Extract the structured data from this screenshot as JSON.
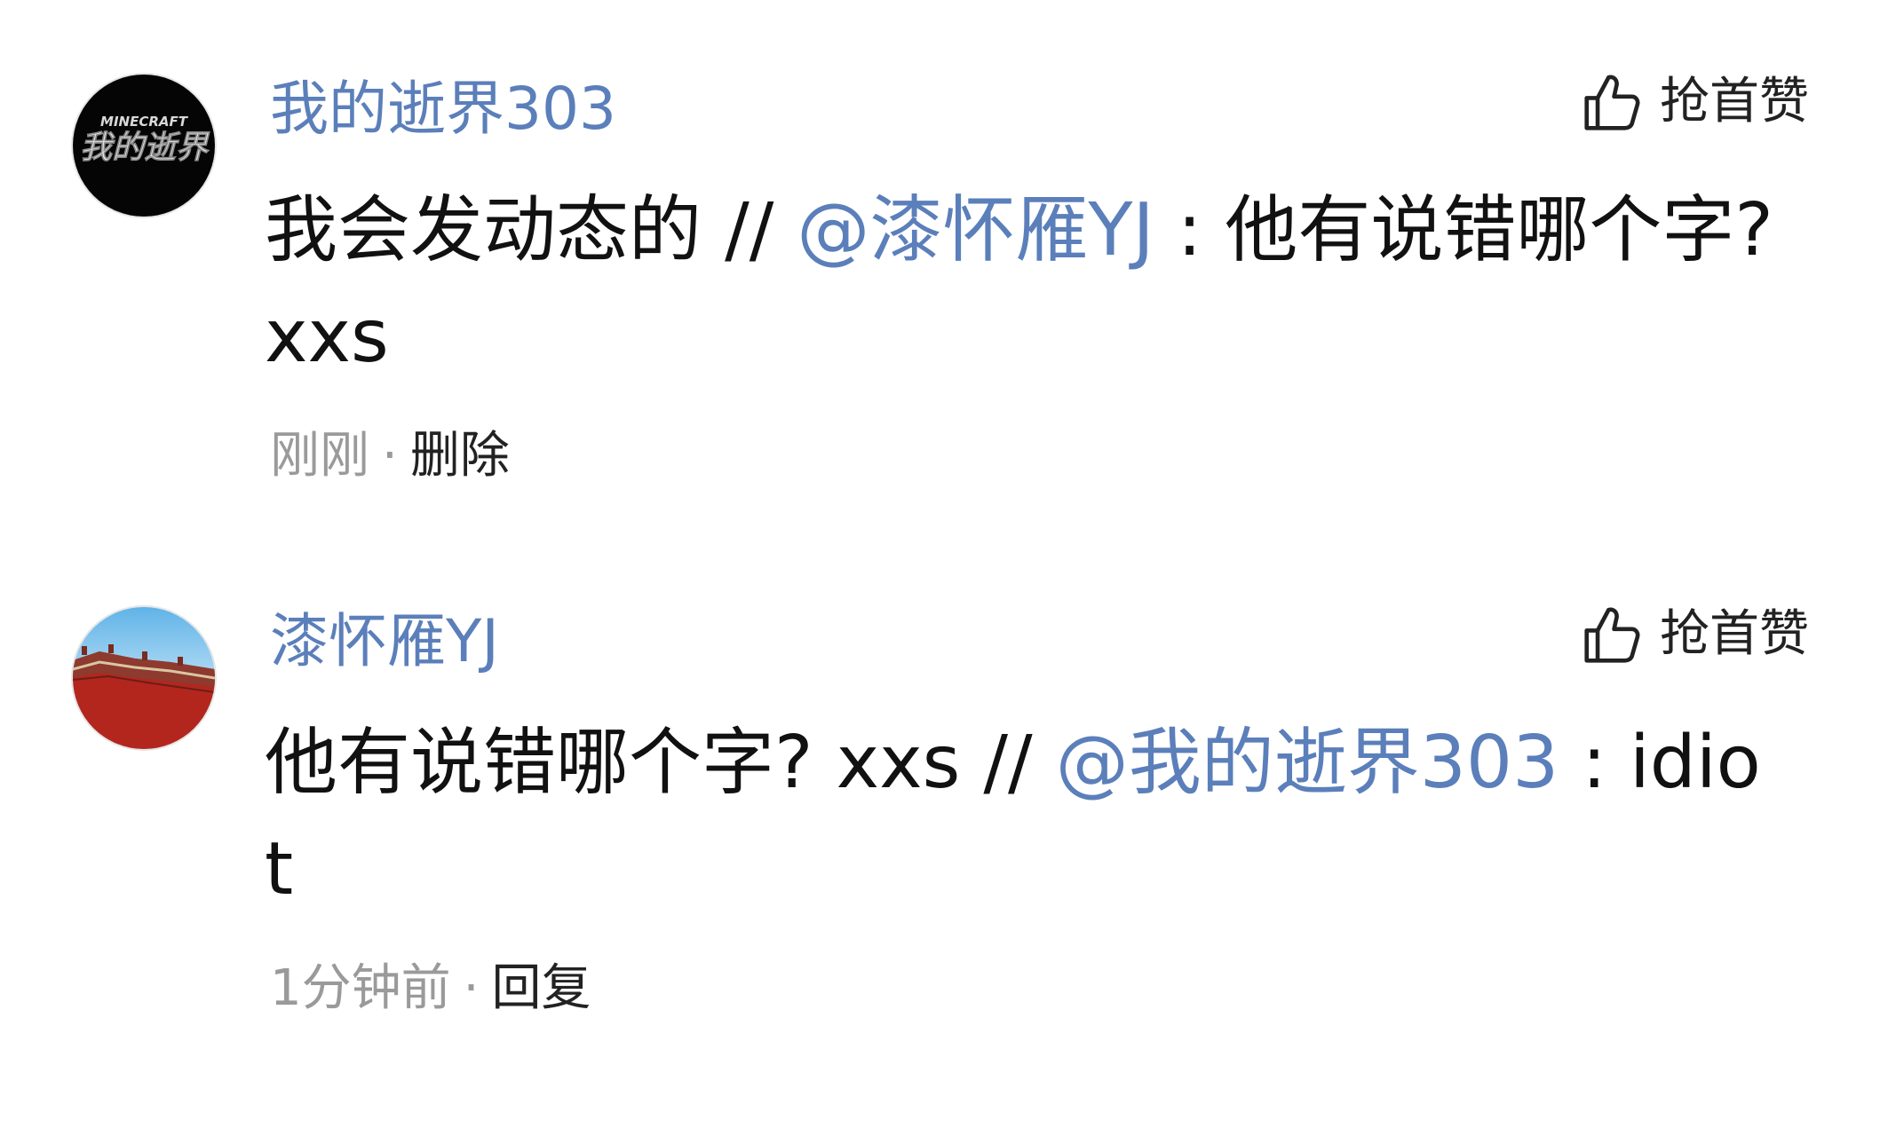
{
  "colors": {
    "mention": "#5b7fba",
    "username": "#5b7fba",
    "meta_text": "#9a9a9a",
    "body_text": "#111111"
  },
  "comments": [
    {
      "username": "我的逝界303",
      "avatar_icon": "minecraft-logo-avatar",
      "avatar_text_top": "MINECRAFT",
      "avatar_text_main": "我的逝界",
      "like_icon": "thumbs-up-icon",
      "like_label": "抢首赞",
      "body_text": "我会发动态的 // ",
      "mention": "@漆怀雁YJ",
      "quoted_text": " : 他有说错哪个字? xxs",
      "time": "刚刚",
      "separator": "·",
      "action_label": "删除"
    },
    {
      "username": "漆怀雁YJ",
      "avatar_icon": "palace-wall-avatar",
      "like_icon": "thumbs-up-icon",
      "like_label": "抢首赞",
      "body_text": "他有说错哪个字? xxs // ",
      "mention": "@我的逝界303",
      "quoted_text": " : idiot",
      "time": "1分钟前",
      "separator": "·",
      "action_label": "回复"
    }
  ]
}
